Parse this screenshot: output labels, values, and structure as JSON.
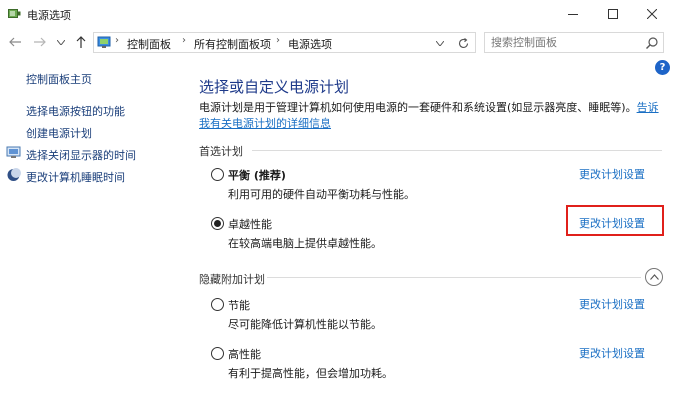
{
  "window": {
    "title": "电源选项",
    "minimize_icon": "minimize-icon",
    "maximize_icon": "maximize-icon",
    "close_icon": "close-icon"
  },
  "address": {
    "breadcrumbs": [
      "控制面板",
      "所有控制面板项",
      "电源选项"
    ],
    "separator": "›",
    "search_placeholder": "搜索控制面板"
  },
  "sidebar": {
    "items": [
      {
        "label": "控制面板主页",
        "icon": null
      },
      {
        "label": "选择电源按钮的功能",
        "icon": null
      },
      {
        "label": "创建电源计划",
        "icon": null
      },
      {
        "label": "选择关闭显示器的时间",
        "icon": "display-icon"
      },
      {
        "label": "更改计算机睡眠时间",
        "icon": "moon-icon"
      }
    ]
  },
  "main": {
    "title": "选择或自定义电源计划",
    "description": "电源计划是用于管理计算机如何使用电源的一套硬件和系统设置(如显示器亮度、睡眠等)。",
    "description_link": "告诉我有关电源计划的详细信息",
    "preferred_section": "首选计划",
    "hidden_section": "隐藏附加计划",
    "plans": [
      {
        "name": "平衡 (推荐)",
        "desc": "利用可用的硬件自动平衡功耗与性能。",
        "link": "更改计划设置",
        "selected": false
      },
      {
        "name": "卓越性能",
        "desc": "在较高端电脑上提供卓越性能。",
        "link": "更改计划设置",
        "selected": true
      },
      {
        "name": "节能",
        "desc": "尽可能降低计算机性能以节能。",
        "link": "更改计划设置",
        "selected": false
      },
      {
        "name": "高性能",
        "desc": "有利于提高性能，但会增加功耗。",
        "link": "更改计划设置",
        "selected": false
      }
    ]
  },
  "help_label": "?",
  "colors": {
    "link": "#1a6fc4",
    "title": "#1e3a8a",
    "highlight": "#e0201b",
    "help": "#1e64c8"
  }
}
